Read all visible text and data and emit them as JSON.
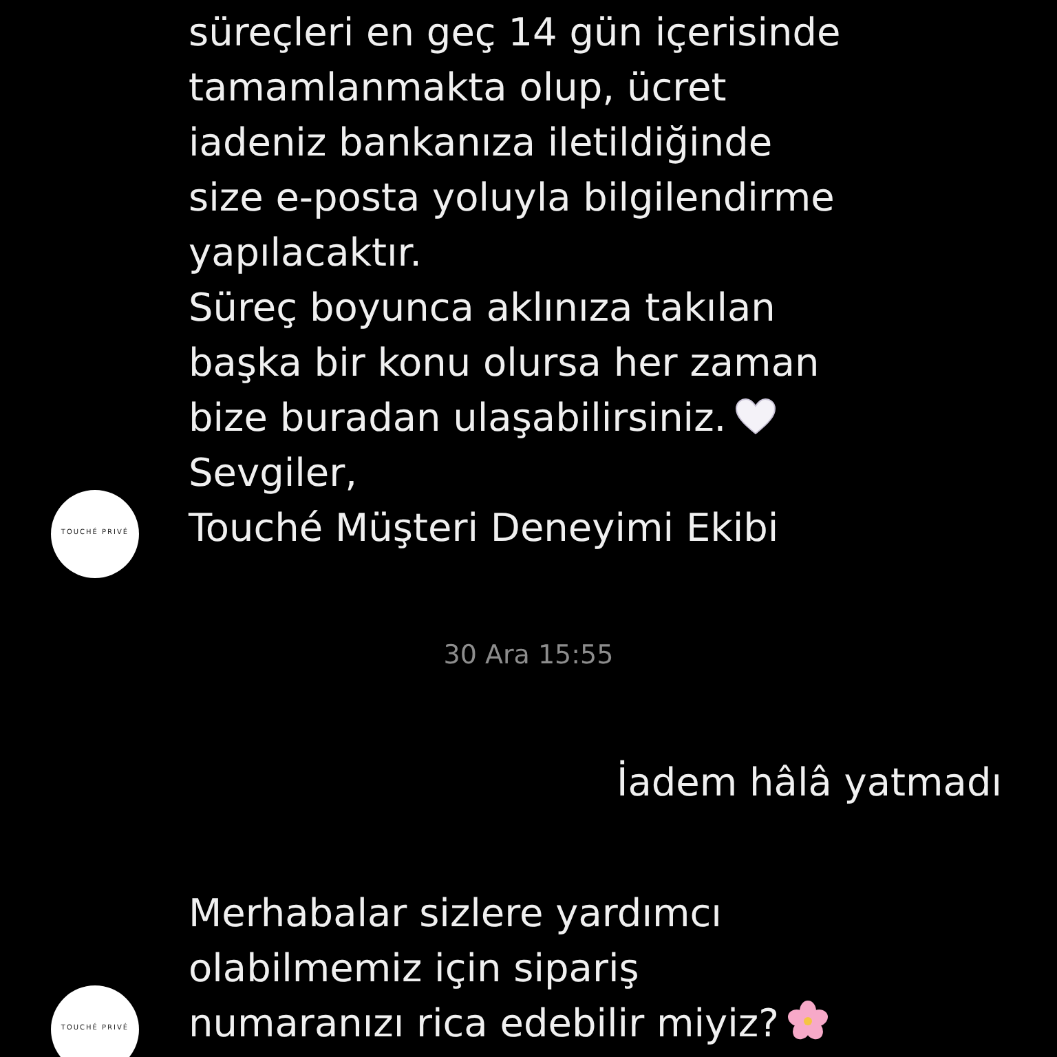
{
  "messages": [
    {
      "kind": "incoming",
      "avatar": "TOUCHÉ PRIVÉ",
      "lines": [
        "süreçleri en geç 14 gün içerisinde",
        "tamamlanmakta olup, ücret",
        "iadeniz bankanıza iletildiğinde",
        "size e-posta yoluyla bilgilendirme",
        "yapılacaktır.",
        "Süreç boyunca aklınıza takılan",
        "başka bir konu olursa her zaman",
        {
          "text": "bize buradan ulaşabilirsiniz.",
          "kind": "heart"
        },
        "Sevgiler,",
        "Touché Müşteri Deneyimi Ekibi"
      ]
    },
    {
      "kind": "timestamp",
      "text": "30 Ara 15:55"
    },
    {
      "kind": "outgoing",
      "lines": [
        "İadem hâlâ yatmadı"
      ]
    },
    {
      "kind": "incoming",
      "avatar": "TOUCHÉ PRIVÉ",
      "lines": [
        "Merhabalar sizlere yardımcı",
        "olabilmemiz için sipariş",
        {
          "text": "numaranızı rica edebilir miyiz?",
          "kind": "blossom"
        }
      ]
    }
  ]
}
